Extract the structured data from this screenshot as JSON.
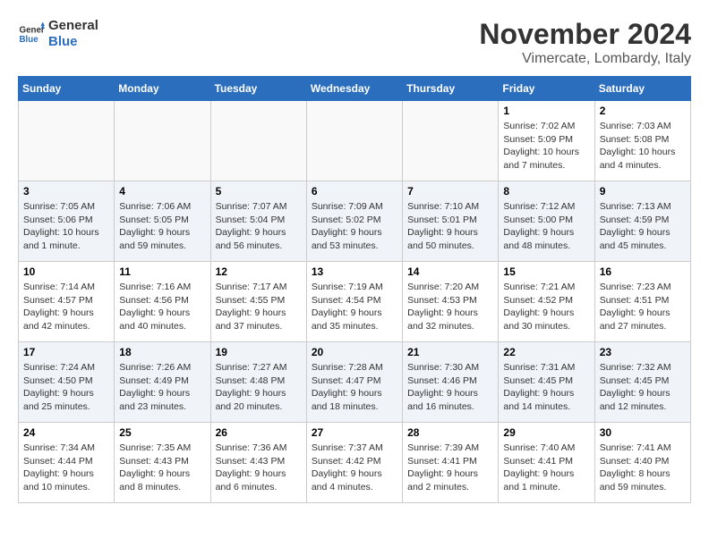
{
  "logo": {
    "general": "General",
    "blue": "Blue"
  },
  "title": "November 2024",
  "subtitle": "Vimercate, Lombardy, Italy",
  "weekdays": [
    "Sunday",
    "Monday",
    "Tuesday",
    "Wednesday",
    "Thursday",
    "Friday",
    "Saturday"
  ],
  "weeks": [
    [
      {
        "day": "",
        "info": ""
      },
      {
        "day": "",
        "info": ""
      },
      {
        "day": "",
        "info": ""
      },
      {
        "day": "",
        "info": ""
      },
      {
        "day": "",
        "info": ""
      },
      {
        "day": "1",
        "info": "Sunrise: 7:02 AM\nSunset: 5:09 PM\nDaylight: 10 hours and 7 minutes."
      },
      {
        "day": "2",
        "info": "Sunrise: 7:03 AM\nSunset: 5:08 PM\nDaylight: 10 hours and 4 minutes."
      }
    ],
    [
      {
        "day": "3",
        "info": "Sunrise: 7:05 AM\nSunset: 5:06 PM\nDaylight: 10 hours and 1 minute."
      },
      {
        "day": "4",
        "info": "Sunrise: 7:06 AM\nSunset: 5:05 PM\nDaylight: 9 hours and 59 minutes."
      },
      {
        "day": "5",
        "info": "Sunrise: 7:07 AM\nSunset: 5:04 PM\nDaylight: 9 hours and 56 minutes."
      },
      {
        "day": "6",
        "info": "Sunrise: 7:09 AM\nSunset: 5:02 PM\nDaylight: 9 hours and 53 minutes."
      },
      {
        "day": "7",
        "info": "Sunrise: 7:10 AM\nSunset: 5:01 PM\nDaylight: 9 hours and 50 minutes."
      },
      {
        "day": "8",
        "info": "Sunrise: 7:12 AM\nSunset: 5:00 PM\nDaylight: 9 hours and 48 minutes."
      },
      {
        "day": "9",
        "info": "Sunrise: 7:13 AM\nSunset: 4:59 PM\nDaylight: 9 hours and 45 minutes."
      }
    ],
    [
      {
        "day": "10",
        "info": "Sunrise: 7:14 AM\nSunset: 4:57 PM\nDaylight: 9 hours and 42 minutes."
      },
      {
        "day": "11",
        "info": "Sunrise: 7:16 AM\nSunset: 4:56 PM\nDaylight: 9 hours and 40 minutes."
      },
      {
        "day": "12",
        "info": "Sunrise: 7:17 AM\nSunset: 4:55 PM\nDaylight: 9 hours and 37 minutes."
      },
      {
        "day": "13",
        "info": "Sunrise: 7:19 AM\nSunset: 4:54 PM\nDaylight: 9 hours and 35 minutes."
      },
      {
        "day": "14",
        "info": "Sunrise: 7:20 AM\nSunset: 4:53 PM\nDaylight: 9 hours and 32 minutes."
      },
      {
        "day": "15",
        "info": "Sunrise: 7:21 AM\nSunset: 4:52 PM\nDaylight: 9 hours and 30 minutes."
      },
      {
        "day": "16",
        "info": "Sunrise: 7:23 AM\nSunset: 4:51 PM\nDaylight: 9 hours and 27 minutes."
      }
    ],
    [
      {
        "day": "17",
        "info": "Sunrise: 7:24 AM\nSunset: 4:50 PM\nDaylight: 9 hours and 25 minutes."
      },
      {
        "day": "18",
        "info": "Sunrise: 7:26 AM\nSunset: 4:49 PM\nDaylight: 9 hours and 23 minutes."
      },
      {
        "day": "19",
        "info": "Sunrise: 7:27 AM\nSunset: 4:48 PM\nDaylight: 9 hours and 20 minutes."
      },
      {
        "day": "20",
        "info": "Sunrise: 7:28 AM\nSunset: 4:47 PM\nDaylight: 9 hours and 18 minutes."
      },
      {
        "day": "21",
        "info": "Sunrise: 7:30 AM\nSunset: 4:46 PM\nDaylight: 9 hours and 16 minutes."
      },
      {
        "day": "22",
        "info": "Sunrise: 7:31 AM\nSunset: 4:45 PM\nDaylight: 9 hours and 14 minutes."
      },
      {
        "day": "23",
        "info": "Sunrise: 7:32 AM\nSunset: 4:45 PM\nDaylight: 9 hours and 12 minutes."
      }
    ],
    [
      {
        "day": "24",
        "info": "Sunrise: 7:34 AM\nSunset: 4:44 PM\nDaylight: 9 hours and 10 minutes."
      },
      {
        "day": "25",
        "info": "Sunrise: 7:35 AM\nSunset: 4:43 PM\nDaylight: 9 hours and 8 minutes."
      },
      {
        "day": "26",
        "info": "Sunrise: 7:36 AM\nSunset: 4:43 PM\nDaylight: 9 hours and 6 minutes."
      },
      {
        "day": "27",
        "info": "Sunrise: 7:37 AM\nSunset: 4:42 PM\nDaylight: 9 hours and 4 minutes."
      },
      {
        "day": "28",
        "info": "Sunrise: 7:39 AM\nSunset: 4:41 PM\nDaylight: 9 hours and 2 minutes."
      },
      {
        "day": "29",
        "info": "Sunrise: 7:40 AM\nSunset: 4:41 PM\nDaylight: 9 hours and 1 minute."
      },
      {
        "day": "30",
        "info": "Sunrise: 7:41 AM\nSunset: 4:40 PM\nDaylight: 8 hours and 59 minutes."
      }
    ]
  ]
}
